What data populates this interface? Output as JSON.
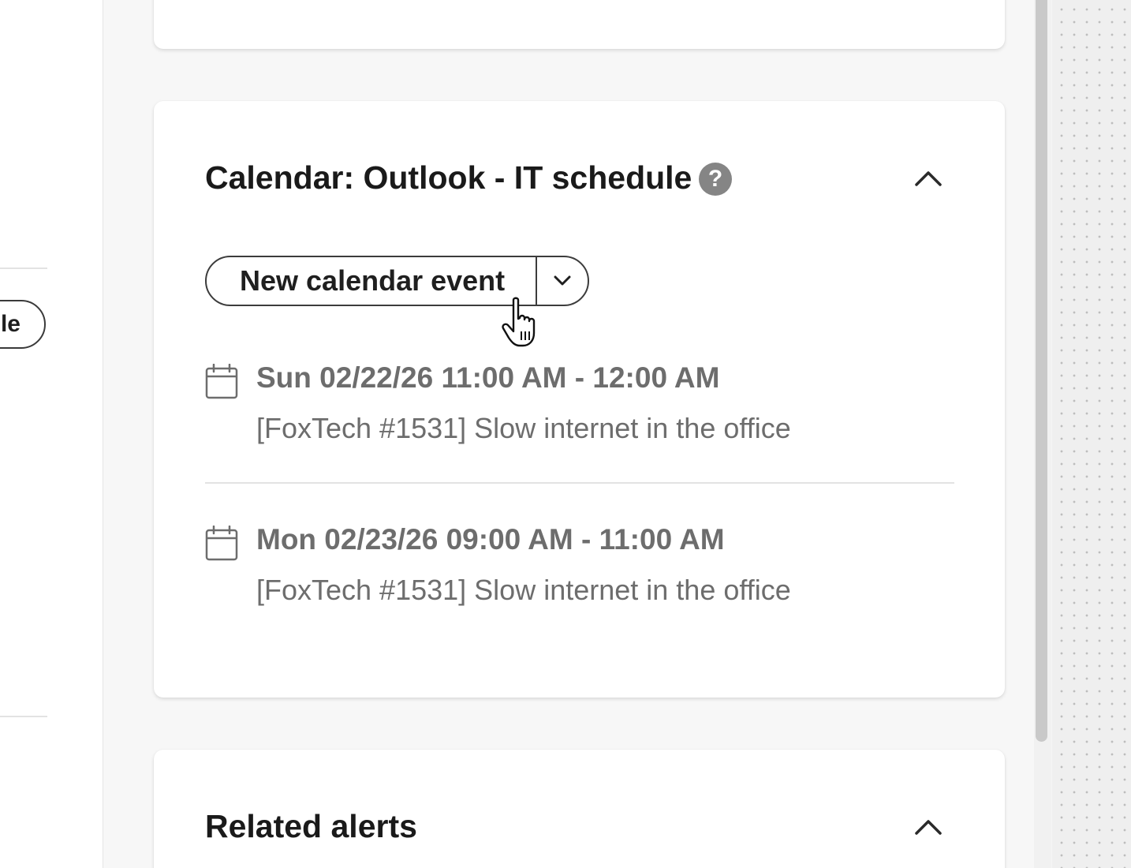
{
  "left_panel": {
    "pill_partial_text": "le"
  },
  "calendar_card": {
    "title": "Calendar: Outlook - IT schedule",
    "help_icon_glyph": "?",
    "help_icon": "help-circle-icon",
    "collapse_icon": "chevron-up-icon",
    "new_event_button": {
      "label": "New calendar event",
      "dropdown_icon": "chevron-down-icon"
    },
    "events": [
      {
        "when": "Sun 02/22/26 11:00 AM - 12:00 AM",
        "subject": "[FoxTech #1531] Slow internet in the office",
        "icon": "calendar-icon"
      },
      {
        "when": "Mon 02/23/26 09:00 AM - 11:00 AM",
        "subject": "[FoxTech #1531] Slow internet in the office",
        "icon": "calendar-icon"
      }
    ]
  },
  "alerts_card": {
    "title": "Related alerts",
    "collapse_icon": "chevron-up-icon"
  },
  "colors": {
    "page_bg": "#f7f7f7",
    "card_bg": "#ffffff",
    "title_text": "#1a1a1a",
    "muted_text": "#6d6d6d",
    "help_icon_bg": "#858585",
    "border": "#3c3c3c"
  }
}
